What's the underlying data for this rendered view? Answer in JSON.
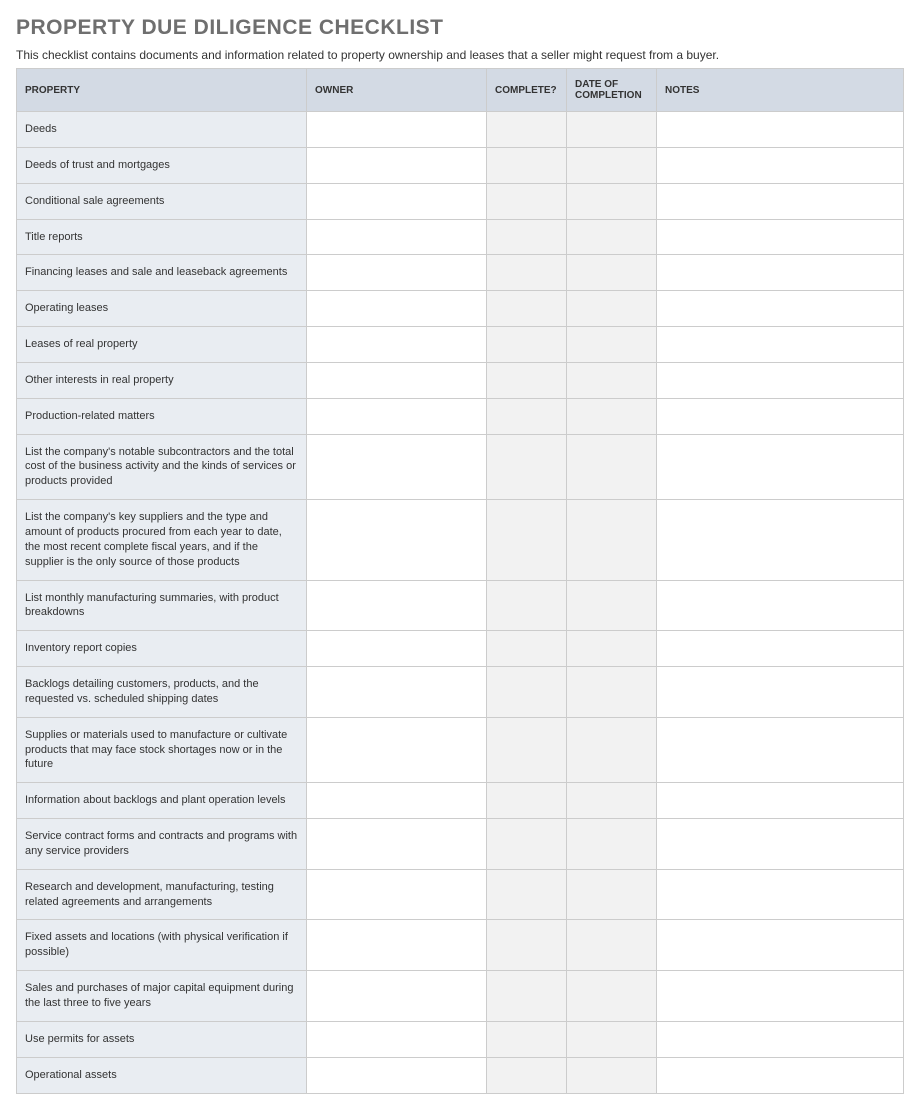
{
  "title": "PROPERTY DUE DILIGENCE CHECKLIST",
  "description": "This checklist contains documents and information related to property ownership and leases that a seller might request from a buyer.",
  "headers": {
    "property": "PROPERTY",
    "owner": "OWNER",
    "complete": "COMPLETE?",
    "date": "DATE OF COMPLETION",
    "notes": "NOTES"
  },
  "rows": [
    {
      "property": "Deeds",
      "owner": "",
      "complete": "",
      "date": "",
      "notes": ""
    },
    {
      "property": "Deeds of trust and mortgages",
      "owner": "",
      "complete": "",
      "date": "",
      "notes": ""
    },
    {
      "property": "Conditional sale agreements",
      "owner": "",
      "complete": "",
      "date": "",
      "notes": ""
    },
    {
      "property": "Title reports",
      "owner": "",
      "complete": "",
      "date": "",
      "notes": ""
    },
    {
      "property": "Financing leases and sale and leaseback agreements",
      "owner": "",
      "complete": "",
      "date": "",
      "notes": ""
    },
    {
      "property": "Operating leases",
      "owner": "",
      "complete": "",
      "date": "",
      "notes": ""
    },
    {
      "property": "Leases of real property",
      "owner": "",
      "complete": "",
      "date": "",
      "notes": ""
    },
    {
      "property": "Other interests in real property",
      "owner": "",
      "complete": "",
      "date": "",
      "notes": ""
    },
    {
      "property": "Production-related matters",
      "owner": "",
      "complete": "",
      "date": "",
      "notes": ""
    },
    {
      "property": "List the company's notable subcontractors and the total cost of the business activity and the kinds of services or products provided",
      "owner": "",
      "complete": "",
      "date": "",
      "notes": ""
    },
    {
      "property": "List the company's key suppliers and the type and amount of products procured from each year to date, the most recent complete fiscal years, and if the supplier is the only source of those products",
      "owner": "",
      "complete": "",
      "date": "",
      "notes": ""
    },
    {
      "property": "List monthly manufacturing summaries, with product breakdowns",
      "owner": "",
      "complete": "",
      "date": "",
      "notes": ""
    },
    {
      "property": "Inventory report copies",
      "owner": "",
      "complete": "",
      "date": "",
      "notes": ""
    },
    {
      "property": "Backlogs detailing customers, products, and the requested vs. scheduled shipping dates",
      "owner": "",
      "complete": "",
      "date": "",
      "notes": ""
    },
    {
      "property": "Supplies or materials used to manufacture or cultivate products that may face stock shortages now or in the future",
      "owner": "",
      "complete": "",
      "date": "",
      "notes": ""
    },
    {
      "property": "Information about backlogs and plant operation levels",
      "owner": "",
      "complete": "",
      "date": "",
      "notes": ""
    },
    {
      "property": "Service contract forms and contracts and programs with any service providers",
      "owner": "",
      "complete": "",
      "date": "",
      "notes": ""
    },
    {
      "property": "Research and development, manufacturing, testing related agreements and arrangements",
      "owner": "",
      "complete": "",
      "date": "",
      "notes": ""
    },
    {
      "property": "Fixed assets and locations (with physical verification if possible)",
      "owner": "",
      "complete": "",
      "date": "",
      "notes": ""
    },
    {
      "property": "Sales and purchases of major capital equipment during the last three to five years",
      "owner": "",
      "complete": "",
      "date": "",
      "notes": ""
    },
    {
      "property": "Use permits for assets",
      "owner": "",
      "complete": "",
      "date": "",
      "notes": ""
    },
    {
      "property": "Operational assets",
      "owner": "",
      "complete": "",
      "date": "",
      "notes": ""
    }
  ]
}
